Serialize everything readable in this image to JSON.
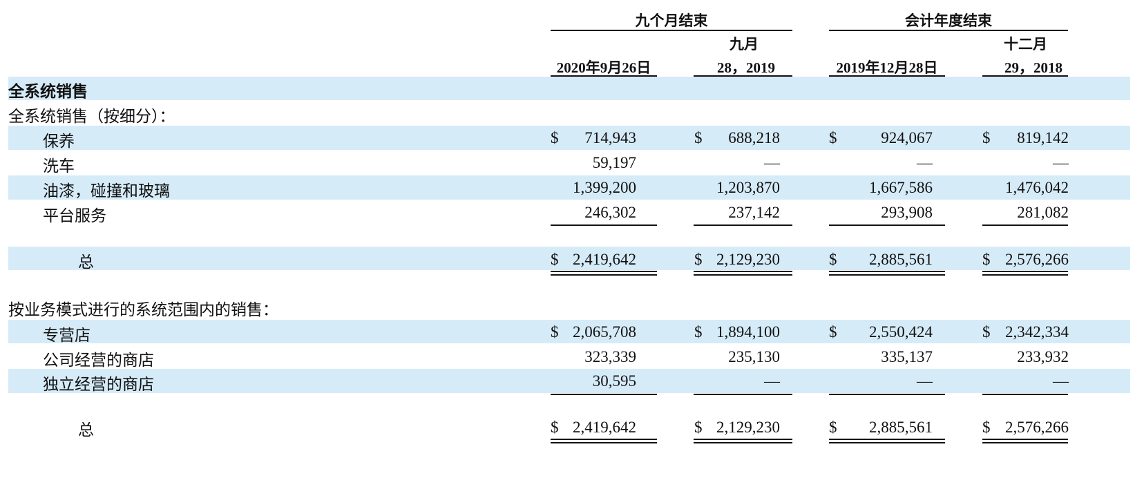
{
  "header": {
    "group1": "九个月结束",
    "group2": "会计年度结束",
    "col2_top": "九月",
    "col4_top": "十二月",
    "col1": "2020年9月26日",
    "col2": "28，2019",
    "col3": "2019年12月28日",
    "col4": "29，2018"
  },
  "section1": {
    "title": "全系统销售",
    "subtitle": "全系统销售（按细分）："
  },
  "section2": {
    "subtitle": "按业务模式进行的系统范围内的销售："
  },
  "currency": "$",
  "dash": "—",
  "rows1": [
    {
      "label": "保养",
      "v": [
        "714,943",
        "688,218",
        "924,067",
        "819,142"
      ]
    },
    {
      "label": "洗车",
      "v": [
        "59,197",
        "—",
        "—",
        "—"
      ]
    },
    {
      "label": "油漆，碰撞和玻璃",
      "v": [
        "1,399,200",
        "1,203,870",
        "1,667,586",
        "1,476,042"
      ]
    },
    {
      "label": "平台服务",
      "v": [
        "246,302",
        "237,142",
        "293,908",
        "281,082"
      ]
    }
  ],
  "total1": {
    "label": "总",
    "v": [
      "2,419,642",
      "2,129,230",
      "2,885,561",
      "2,576,266"
    ]
  },
  "rows2": [
    {
      "label": "专营店",
      "v": [
        "2,065,708",
        "1,894,100",
        "2,550,424",
        "2,342,334"
      ]
    },
    {
      "label": "公司经营的商店",
      "v": [
        "323,339",
        "235,130",
        "335,137",
        "233,932"
      ]
    },
    {
      "label": "独立经营的商店",
      "v": [
        "30,595",
        "—",
        "—",
        "—"
      ]
    }
  ],
  "total2": {
    "label": "总",
    "v": [
      "2,419,642",
      "2,129,230",
      "2,885,561",
      "2,576,266"
    ]
  }
}
